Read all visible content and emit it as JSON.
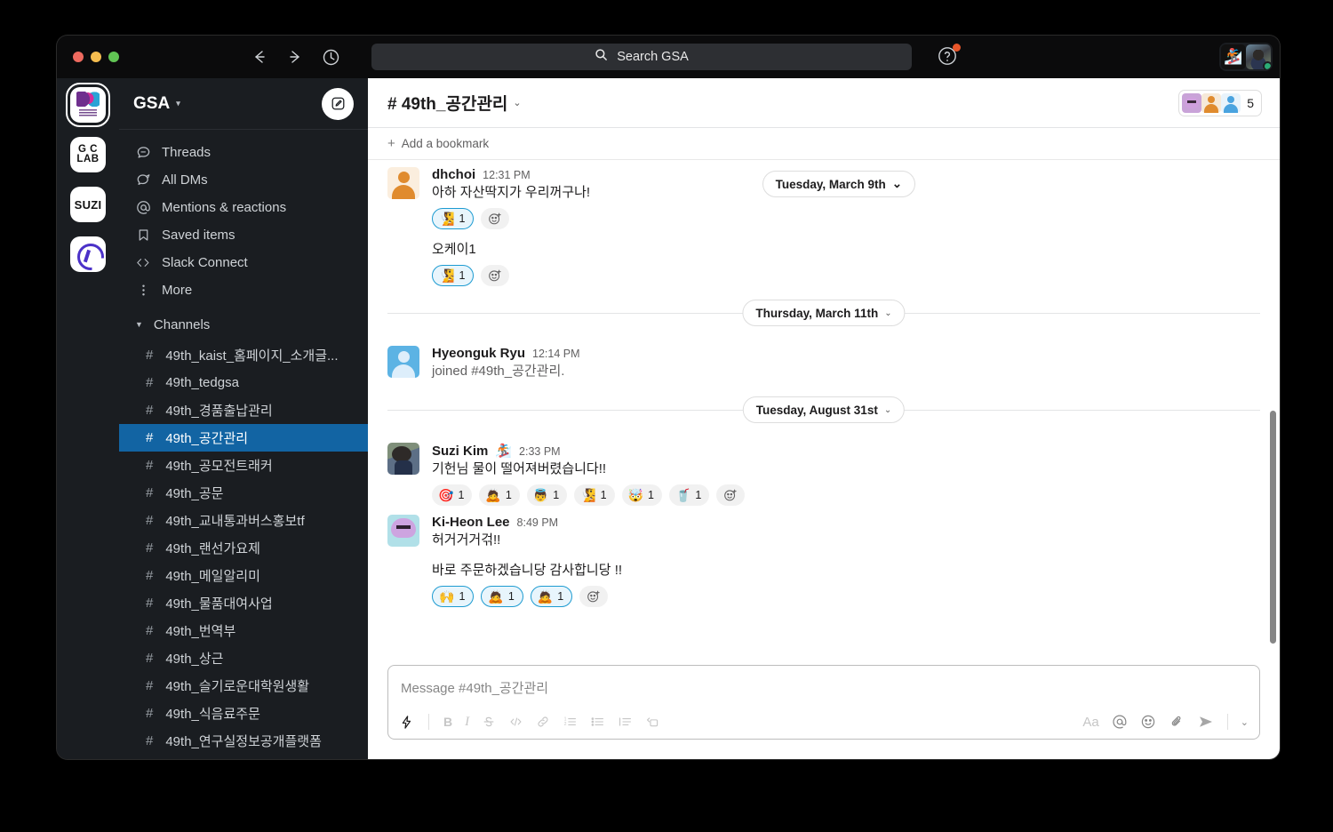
{
  "window": {
    "traffic_lights": [
      "close",
      "minimize",
      "maximize"
    ],
    "nav": {
      "back": "back-arrow",
      "forward": "forward-arrow",
      "history": "history-clock"
    },
    "search": {
      "placeholder": "Search GSA",
      "value": "Search GSA",
      "icon": "search-icon"
    },
    "help": {
      "icon": "help-icon",
      "has_badge": true
    },
    "accent": "#1264a3"
  },
  "rail": {
    "workspaces": [
      {
        "name": "GSA",
        "label": "",
        "active": true,
        "icon": "gsa-logo"
      },
      {
        "name": "GC LAB",
        "label_top": "G C",
        "label_bottom": "LAB",
        "active": false
      },
      {
        "name": "SUZI",
        "label": "SUZI",
        "active": false
      },
      {
        "name": "W",
        "label": "",
        "active": false,
        "icon": "w-logo"
      }
    ]
  },
  "sidebar": {
    "workspace_name": "GSA",
    "compose_icon": "compose-pencil-icon",
    "nav_items": [
      {
        "label": "Threads",
        "icon": "threads-icon"
      },
      {
        "label": "All DMs",
        "icon": "dms-icon"
      },
      {
        "label": "Mentions & reactions",
        "icon": "at-icon"
      },
      {
        "label": "Saved items",
        "icon": "bookmark-icon"
      },
      {
        "label": "Slack Connect",
        "icon": "slack-connect-icon"
      },
      {
        "label": "More",
        "icon": "more-dots-icon"
      }
    ],
    "section_label": "Channels",
    "channels": [
      {
        "name": "49th_kaist_홈페이지_소개글...",
        "selected": false
      },
      {
        "name": "49th_tedgsa",
        "selected": false
      },
      {
        "name": "49th_경품출납관리",
        "selected": false
      },
      {
        "name": "49th_공간관리",
        "selected": true
      },
      {
        "name": "49th_공모전트래커",
        "selected": false
      },
      {
        "name": "49th_공문",
        "selected": false
      },
      {
        "name": "49th_교내통과버스홍보tf",
        "selected": false
      },
      {
        "name": "49th_랜선가요제",
        "selected": false
      },
      {
        "name": "49th_메일알리미",
        "selected": false
      },
      {
        "name": "49th_물품대여사업",
        "selected": false
      },
      {
        "name": "49th_번역부",
        "selected": false
      },
      {
        "name": "49th_상근",
        "selected": false
      },
      {
        "name": "49th_슬기로운대학원생활",
        "selected": false
      },
      {
        "name": "49th_식음료주문",
        "selected": false
      },
      {
        "name": "49th_연구실정보공개플랫폼",
        "selected": false
      }
    ]
  },
  "channel": {
    "title": "# 49th_공간관리",
    "member_count": "5",
    "bookmark_label": "Add a bookmark",
    "bookmark_plus": "+"
  },
  "floating_date": {
    "label": "Tuesday, March 9th"
  },
  "messages": [
    {
      "id": "m1",
      "author": "dhchoi",
      "time": "12:31 PM",
      "avatar": "av-orange",
      "text": "아하 자산딱지가 우리꺼구나!",
      "reactions": [
        {
          "emoji": "🧏",
          "count": "1",
          "mine": true
        }
      ],
      "extra_text": "오케이1",
      "extra_reactions": [
        {
          "emoji": "🧏",
          "count": "1",
          "mine": true
        }
      ]
    },
    {
      "id": "m2",
      "author": "Hyeonguk Ryu",
      "time": "12:14 PM",
      "avatar": "av-blue",
      "text": "joined #49th_공간관리.",
      "is_join": true
    },
    {
      "id": "m3",
      "author": "Suzi Kim",
      "author_emoji": "🏂",
      "time": "2:33 PM",
      "avatar": "av-suzi",
      "text": "기헌님 물이 떨어져버렸습니다!!",
      "reactions": [
        {
          "emoji": "🎯",
          "count": "1",
          "mine": false
        },
        {
          "emoji": "🙇",
          "count": "1",
          "mine": false
        },
        {
          "emoji": "👼",
          "count": "1",
          "mine": false
        },
        {
          "emoji": "🧏",
          "count": "1",
          "mine": false
        },
        {
          "emoji": "🤯",
          "count": "1",
          "mine": false
        },
        {
          "emoji": "🥤",
          "count": "1",
          "mine": false
        }
      ]
    },
    {
      "id": "m4",
      "author": "Ki-Heon Lee",
      "time": "8:49 PM",
      "avatar": "av-octo",
      "text": "허거거거걲!!",
      "extra_text": "바로 주문하겠습니당 감사합니당 !!",
      "extra_reactions": [
        {
          "emoji": "🙌",
          "count": "1",
          "mine": true
        },
        {
          "emoji": "🙇",
          "count": "1",
          "mine": true
        },
        {
          "emoji": "🙇",
          "count": "1",
          "mine": true
        }
      ]
    }
  ],
  "date_dividers": [
    {
      "label": "Thursday, March 11th"
    },
    {
      "label": "Tuesday, August 31st"
    }
  ],
  "composer": {
    "placeholder": "Message #49th_공간관리",
    "left_tools": [
      "lightning-icon",
      "bold-icon",
      "italic-icon",
      "strikethrough-icon",
      "code-icon",
      "link-icon",
      "ordered-list-icon",
      "bulleted-list-icon",
      "blockquote-icon",
      "code-block-icon"
    ],
    "right_tools": [
      "format-aa-icon",
      "mention-at-icon",
      "emoji-icon",
      "attach-clip-icon",
      "send-icon",
      "send-options-chevron-icon"
    ],
    "aa_label": "Aa"
  }
}
